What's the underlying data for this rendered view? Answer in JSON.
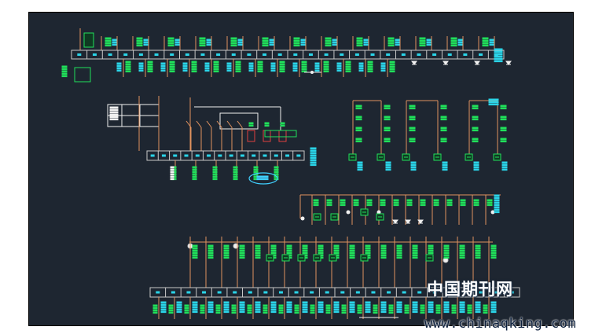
{
  "watermark": {
    "chinese": "中国期刊网",
    "url": "www.chinaqking.com"
  },
  "colors": {
    "background": "#1e2631",
    "device": "#20e05a",
    "wire": "#e0925e",
    "terminal": "#c8c8c8",
    "label": "#2ad4e8",
    "relay": "#f0f0f0",
    "motor": "#40d0ff",
    "fuse": "#e04040"
  },
  "diagram": {
    "sections": [
      "top-terminal-strip",
      "motor-control-circuit",
      "right-relay-panel",
      "middle-relay-row",
      "bottom-terminal-strip"
    ],
    "device_shapes": [
      "relay-coil",
      "contact",
      "diode",
      "fuse",
      "motor",
      "terminal-block"
    ]
  }
}
